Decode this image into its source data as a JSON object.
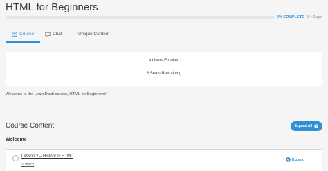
{
  "course": {
    "title": "HTML for Beginners"
  },
  "progress": {
    "percent_text": "0% COMPLETE",
    "steps_text": "0/4 Steps",
    "fraction": 0,
    "accent_color": "#2f8fd8"
  },
  "tabs": [
    {
      "label": "Course",
      "icon": "book-icon",
      "active": true
    },
    {
      "label": "Chat",
      "icon": "chat-icon",
      "active": false
    },
    {
      "label": "Unique Content",
      "active": false
    }
  ],
  "stats": {
    "enrolled": "4 Users Enrolled",
    "seats": "6 Seats Remaining"
  },
  "welcome_text": "Welcome to the LearnDash course, HTML for Beginners!",
  "course_content": {
    "heading": "Course Content",
    "expand_all_label": "Expand All",
    "section_label": "Welcome",
    "lessons": [
      {
        "title": "Lesson 2 – History of HTML",
        "topics": "2 Topics",
        "expand_label": "Expand"
      }
    ]
  }
}
